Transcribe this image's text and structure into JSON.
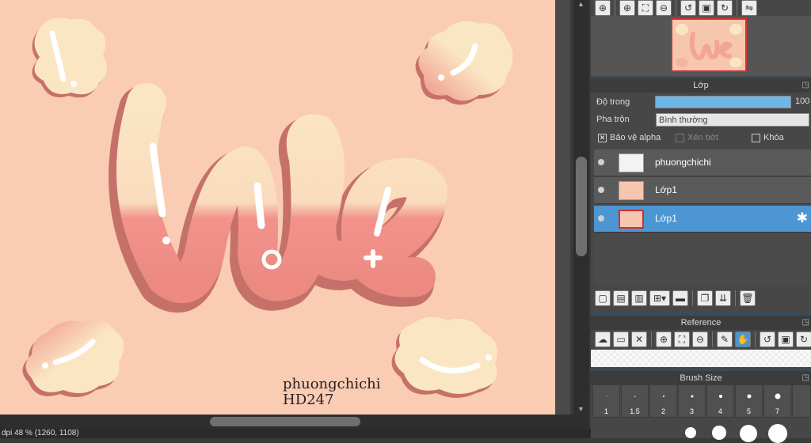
{
  "artwork": {
    "word": "We",
    "signature_line1": "phuongchichi",
    "signature_line2": "HD247",
    "colors": {
      "background": "#f9ccb3",
      "cream": "#fbe6c4",
      "coral": "#ef8f86",
      "shadow": "#c5716a"
    }
  },
  "statusbar": {
    "text": "dpi 48 %   (1260, 1108)"
  },
  "navigator": {
    "tools": [
      "zoom-in-icon",
      "zoom-plus-icon",
      "fit-icon",
      "zoom-minus-icon",
      "rotate-left-icon",
      "fit-screen-icon",
      "rotate-right-icon",
      "flip-icon"
    ]
  },
  "layer_panel": {
    "title": "Lớp",
    "opacity_label": "Độ trong",
    "opacity_value": "100",
    "opacity_fraction": 1.0,
    "blend_label": "Pha trộn",
    "blend_value": "Bình thường",
    "protect_alpha": "Bảo vệ alpha",
    "clip": "Xén bớt",
    "lock": "Khóa",
    "layers": [
      {
        "name": "phuongchichi",
        "selected": false
      },
      {
        "name": "Lớp1",
        "selected": false
      },
      {
        "name": "Lớp1",
        "selected": true
      }
    ]
  },
  "reference_panel": {
    "title": "Reference"
  },
  "brush_panel": {
    "title": "Brush Size",
    "sizes": [
      "1",
      "1.5",
      "2",
      "3",
      "4",
      "5",
      "7"
    ]
  }
}
